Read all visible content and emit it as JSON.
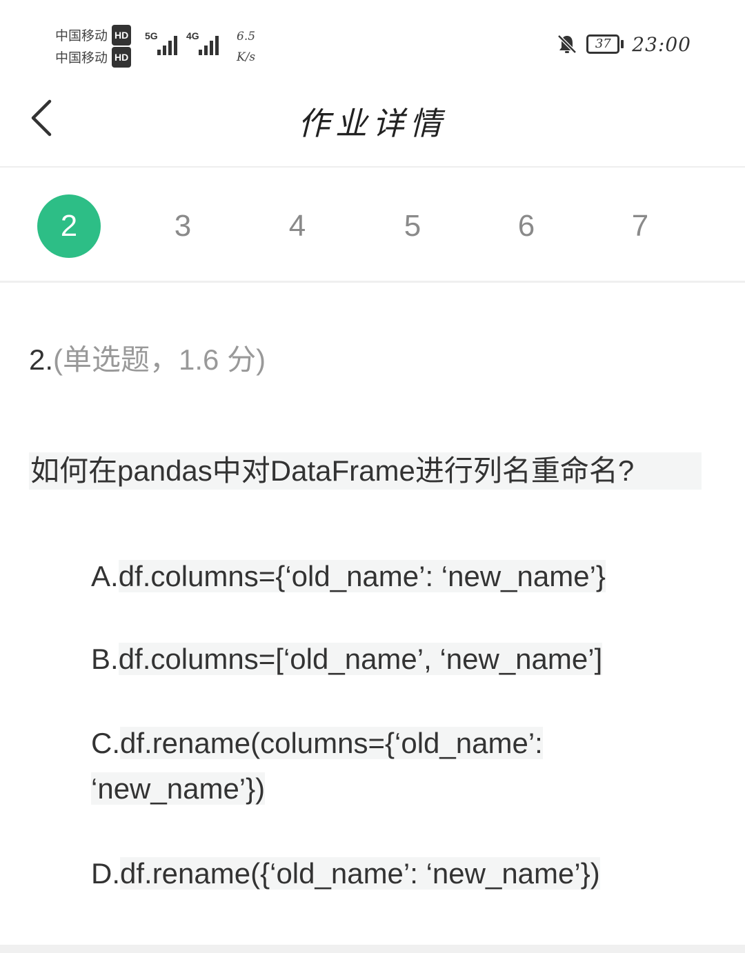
{
  "status_bar": {
    "carrier_1": "中国移动",
    "carrier_2": "中国移动",
    "hd_label": "HD",
    "sig1_label": "5G",
    "sig2_label": "4G",
    "speed_value": "6.5",
    "speed_unit": "K/s",
    "battery": "37",
    "time": "23:00",
    "icons": [
      "bell-off-icon",
      "battery-icon",
      "signal-icon"
    ]
  },
  "header": {
    "title": "作业详情",
    "back_icon": "chevron-left-icon"
  },
  "tabs": [
    {
      "label": "2",
      "active": true
    },
    {
      "label": "3",
      "active": false
    },
    {
      "label": "4",
      "active": false
    },
    {
      "label": "5",
      "active": false
    },
    {
      "label": "6",
      "active": false
    },
    {
      "label": "7",
      "active": false
    }
  ],
  "question": {
    "number": "2.",
    "meta": "(单选题，1.6 分)",
    "text": "如何在pandas中对DataFrame进行列名重命名?",
    "options": [
      {
        "letter": "A.",
        "text": "df.columns={‘old_name’: ‘new_name’}"
      },
      {
        "letter": "B.",
        "text": "df.columns=[‘old_name’, ‘new_name’]"
      },
      {
        "letter": "C.",
        "text": "df.rename(columns={‘old_name’: ‘new_name’})"
      },
      {
        "letter": "D.",
        "text": "df.rename({‘old_name’: ‘new_name’})"
      }
    ]
  },
  "colors": {
    "accent": "#2dbe86",
    "tab_inactive": "#8a8a8a",
    "text": "#333333",
    "meta": "#999999",
    "highlight_bg": "#f4f5f5"
  }
}
